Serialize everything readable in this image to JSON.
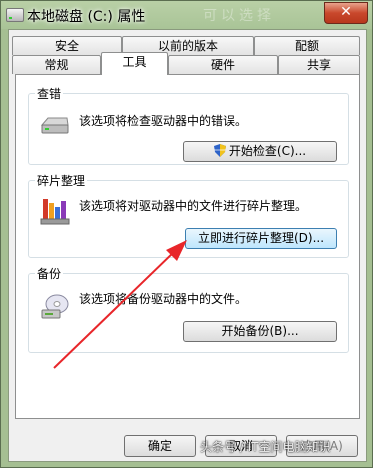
{
  "window": {
    "title": "本地磁盘 (C:) 属性",
    "ghost_text": "可以选择",
    "close_label": "✕"
  },
  "tabs_row1": [
    {
      "label": "安全"
    },
    {
      "label": "以前的版本"
    },
    {
      "label": "配额"
    }
  ],
  "tabs_row2": [
    {
      "label": "常规"
    },
    {
      "label": "工具",
      "active": true
    },
    {
      "label": "硬件"
    },
    {
      "label": "共享"
    }
  ],
  "check": {
    "title": "查错",
    "desc": "该选项将检查驱动器中的错误。",
    "button": "开始检查(C)..."
  },
  "defrag": {
    "title": "碎片整理",
    "desc": "该选项将对驱动器中的文件进行碎片整理。",
    "button": "立即进行碎片整理(D)..."
  },
  "backup": {
    "title": "备份",
    "desc": "该选项将备份驱动器中的文件。",
    "button": "开始备份(B)..."
  },
  "footer": {
    "ok": "确定",
    "cancel": "取消",
    "apply": "应用(A)"
  },
  "watermark": "头条号 / IT空间电脑知识",
  "colors": {
    "arrow": "#e8262a",
    "title_bar": "#a9c497",
    "close": "#c9482c"
  }
}
